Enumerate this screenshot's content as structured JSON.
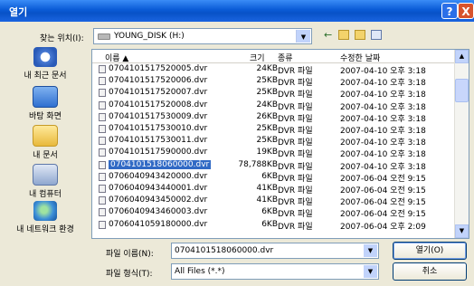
{
  "window": {
    "title": "열기",
    "help_label": "?",
    "close_label": "X"
  },
  "location": {
    "label": "찾는 위치(I):",
    "value": "YOUNG_DISK (H:)"
  },
  "toolbar_icons": [
    "back-arrow-icon",
    "up-folder-icon",
    "new-folder-icon",
    "view-menu-icon"
  ],
  "places": [
    {
      "label": "내 최근 문서",
      "icon": "recent-documents-icon"
    },
    {
      "label": "바탕 화면",
      "icon": "desktop-icon"
    },
    {
      "label": "내 문서",
      "icon": "my-documents-icon"
    },
    {
      "label": "내 컴퓨터",
      "icon": "my-computer-icon"
    },
    {
      "label": "내 네트워크 환경",
      "icon": "network-icon"
    }
  ],
  "columns": {
    "name": "이름",
    "size": "크기",
    "type": "종류",
    "modified": "수정한 날짜"
  },
  "files": [
    {
      "name": "0704101517520005.dvr",
      "size": "24KB",
      "type": "DVR 파일",
      "modified": "2007-04-10 오후 3:18"
    },
    {
      "name": "0704101517520006.dvr",
      "size": "25KB",
      "type": "DVR 파일",
      "modified": "2007-04-10 오후 3:18"
    },
    {
      "name": "0704101517520007.dvr",
      "size": "25KB",
      "type": "DVR 파일",
      "modified": "2007-04-10 오후 3:18"
    },
    {
      "name": "0704101517520008.dvr",
      "size": "24KB",
      "type": "DVR 파일",
      "modified": "2007-04-10 오후 3:18"
    },
    {
      "name": "0704101517530009.dvr",
      "size": "26KB",
      "type": "DVR 파일",
      "modified": "2007-04-10 오후 3:18"
    },
    {
      "name": "0704101517530010.dvr",
      "size": "25KB",
      "type": "DVR 파일",
      "modified": "2007-04-10 오후 3:18"
    },
    {
      "name": "0704101517530011.dvr",
      "size": "25KB",
      "type": "DVR 파일",
      "modified": "2007-04-10 오후 3:18"
    },
    {
      "name": "0704101517590000.dvr",
      "size": "19KB",
      "type": "DVR 파일",
      "modified": "2007-04-10 오후 3:18"
    },
    {
      "name": "0704101518060000.dvr",
      "size": "78,788KB",
      "type": "DVR 파일",
      "modified": "2007-04-10 오후 3:18",
      "selected": true
    },
    {
      "name": "0706040943420000.dvr",
      "size": "6KB",
      "type": "DVR 파일",
      "modified": "2007-06-04 오전 9:15"
    },
    {
      "name": "0706040943440001.dvr",
      "size": "41KB",
      "type": "DVR 파일",
      "modified": "2007-06-04 오전 9:15"
    },
    {
      "name": "0706040943450002.dvr",
      "size": "41KB",
      "type": "DVR 파일",
      "modified": "2007-06-04 오전 9:15"
    },
    {
      "name": "0706040943460003.dvr",
      "size": "6KB",
      "type": "DVR 파일",
      "modified": "2007-06-04 오전 9:15"
    },
    {
      "name": "0706041059180000.dvr",
      "size": "6KB",
      "type": "DVR 파일",
      "modified": "2007-06-04 오후 2:09"
    }
  ],
  "filename": {
    "label": "파일 이름(N):",
    "value": "0704101518060000.dvr"
  },
  "filetype": {
    "label": "파일 형식(T):",
    "value": "All Files (*.*)"
  },
  "buttons": {
    "open": "열기(O)",
    "cancel": "취소"
  },
  "colors": {
    "titlebar": "#0a5bd6",
    "selection": "#316ac5",
    "dialog": "#ece9d8"
  }
}
